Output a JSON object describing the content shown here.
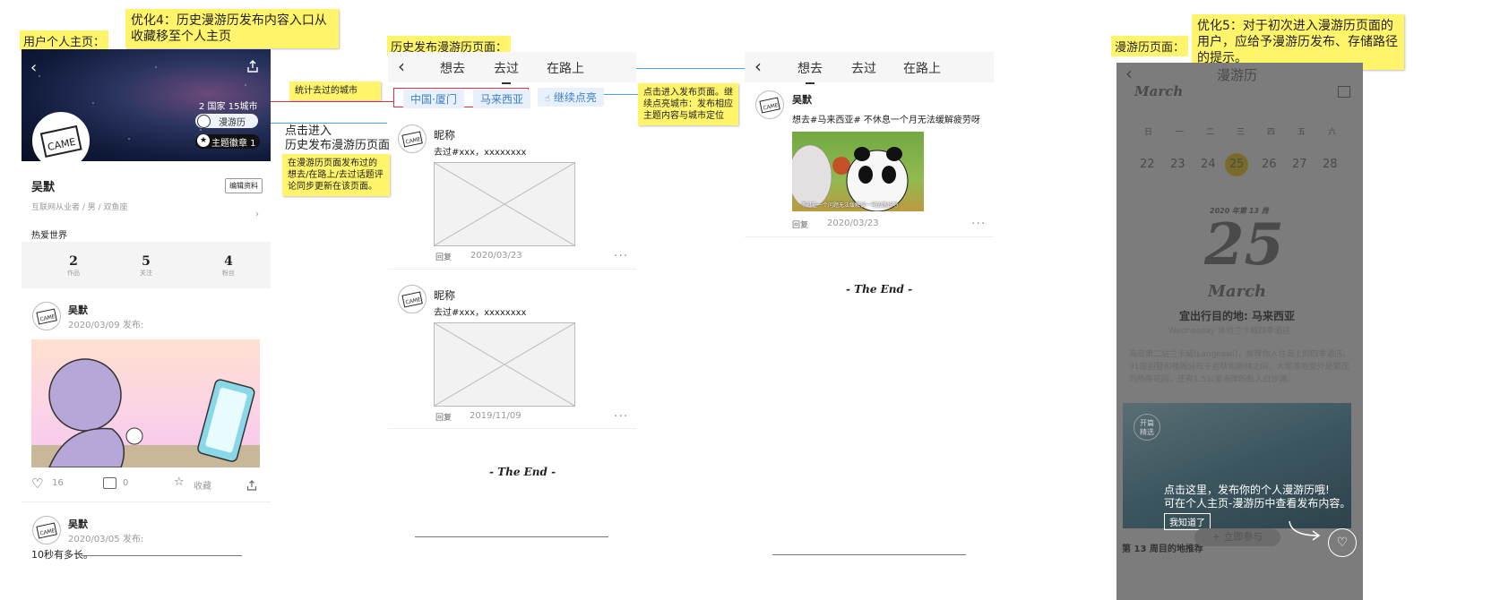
{
  "annotations": {
    "profile_page_title": "用户个人主页：",
    "opt4": "优化4：历史漫游历发布内容入口从收藏移至个人主页",
    "history_page_title": "历史发布漫游历页面：",
    "count_cities": "统计去过的城市",
    "click_enter": "点击进入\n历史发布漫游历页面",
    "sync_note": "在漫游历页面发布过的想去/在路上/去过话题评论同步更新在该页面。",
    "click_publish": "点击进入发布页面。继续点亮城市：发布相应主题内容与城市定位",
    "opt5": "优化5：对于初次进入漫游历页面的用户，应给予漫游历发布、存储路径的提示。",
    "roam_page_title": "漫游历页面："
  },
  "profile": {
    "countries_cities": "2 国家  15城市",
    "roam_label": "漫游历",
    "badge_label": "主题徽章  1",
    "name": "吴默",
    "edit_button": "编辑资料",
    "subtitle": "互联网从业者 / 男 / 双鱼座",
    "bio": "热爱世界",
    "stats": [
      {
        "value": "2",
        "label": "作品"
      },
      {
        "value": "5",
        "label": "关注"
      },
      {
        "value": "4",
        "label": "粉丝"
      }
    ],
    "post1": {
      "name": "吴默",
      "date": "2020/03/09 发布:",
      "likes": "16",
      "comments": "0",
      "fav": "收藏"
    },
    "post2": {
      "name": "吴默",
      "date": "2020/03/05 发布:",
      "text": "10秒有多长。"
    }
  },
  "history": {
    "tabs": [
      "想去",
      "去过",
      "在路上"
    ],
    "chips": [
      "中国·厦门",
      "马来西亚"
    ],
    "continue_button": "继续点亮",
    "posts": [
      {
        "name": "昵称",
        "text": "去过#xxx，xxxxxxxx",
        "reply": "回复",
        "date": "2020/03/23"
      },
      {
        "name": "昵称",
        "text": "去过#xxx，xxxxxxxx",
        "reply": "回复",
        "date": "2019/11/09"
      }
    ],
    "end": "- The End -"
  },
  "want": {
    "tabs": [
      "想去",
      "去过",
      "在路上"
    ],
    "post": {
      "name": "吴默",
      "text": "想去#马来西亚# 不休息一个月无法缓解疲劳呀",
      "caption": "不过在一个问题无法缓解诶一号的路线吧",
      "reply": "回复",
      "date": "2020/03/23"
    },
    "end": "- The End -"
  },
  "roam": {
    "title": "漫游历",
    "month_script": "March",
    "weekdays": [
      "日",
      "一",
      "二",
      "三",
      "四",
      "五",
      "六"
    ],
    "days": [
      "22",
      "23",
      "24",
      "25",
      "26",
      "27",
      "28"
    ],
    "selected_day": "25",
    "week_label": "2020 年第 13 周",
    "big_day": "25",
    "month_big": "March",
    "destination": "宜出行目的地: 马来西亚",
    "sub": "Wednesday 体验兰卡威四季酒店",
    "desc": "海岛第二站兰卡威(Langkawi)，推荐你入住岛上的四季酒店。91座别墅和楼阁分布于岩峡和雨林之间，大堀落地窗外是繁茂的热带花园，还有1.5公里海岸的私人白沙滩。",
    "card_badge": "开篇\n精选",
    "tip_line1": "点击这里，发布你的个人漫游历哦!",
    "tip_line2": "可在个人主页-漫游历中查看发布内容。",
    "got_it": "我知道了",
    "join_button": "+ 立即参与",
    "bottom_text": "第 13 周目的地推荐"
  }
}
